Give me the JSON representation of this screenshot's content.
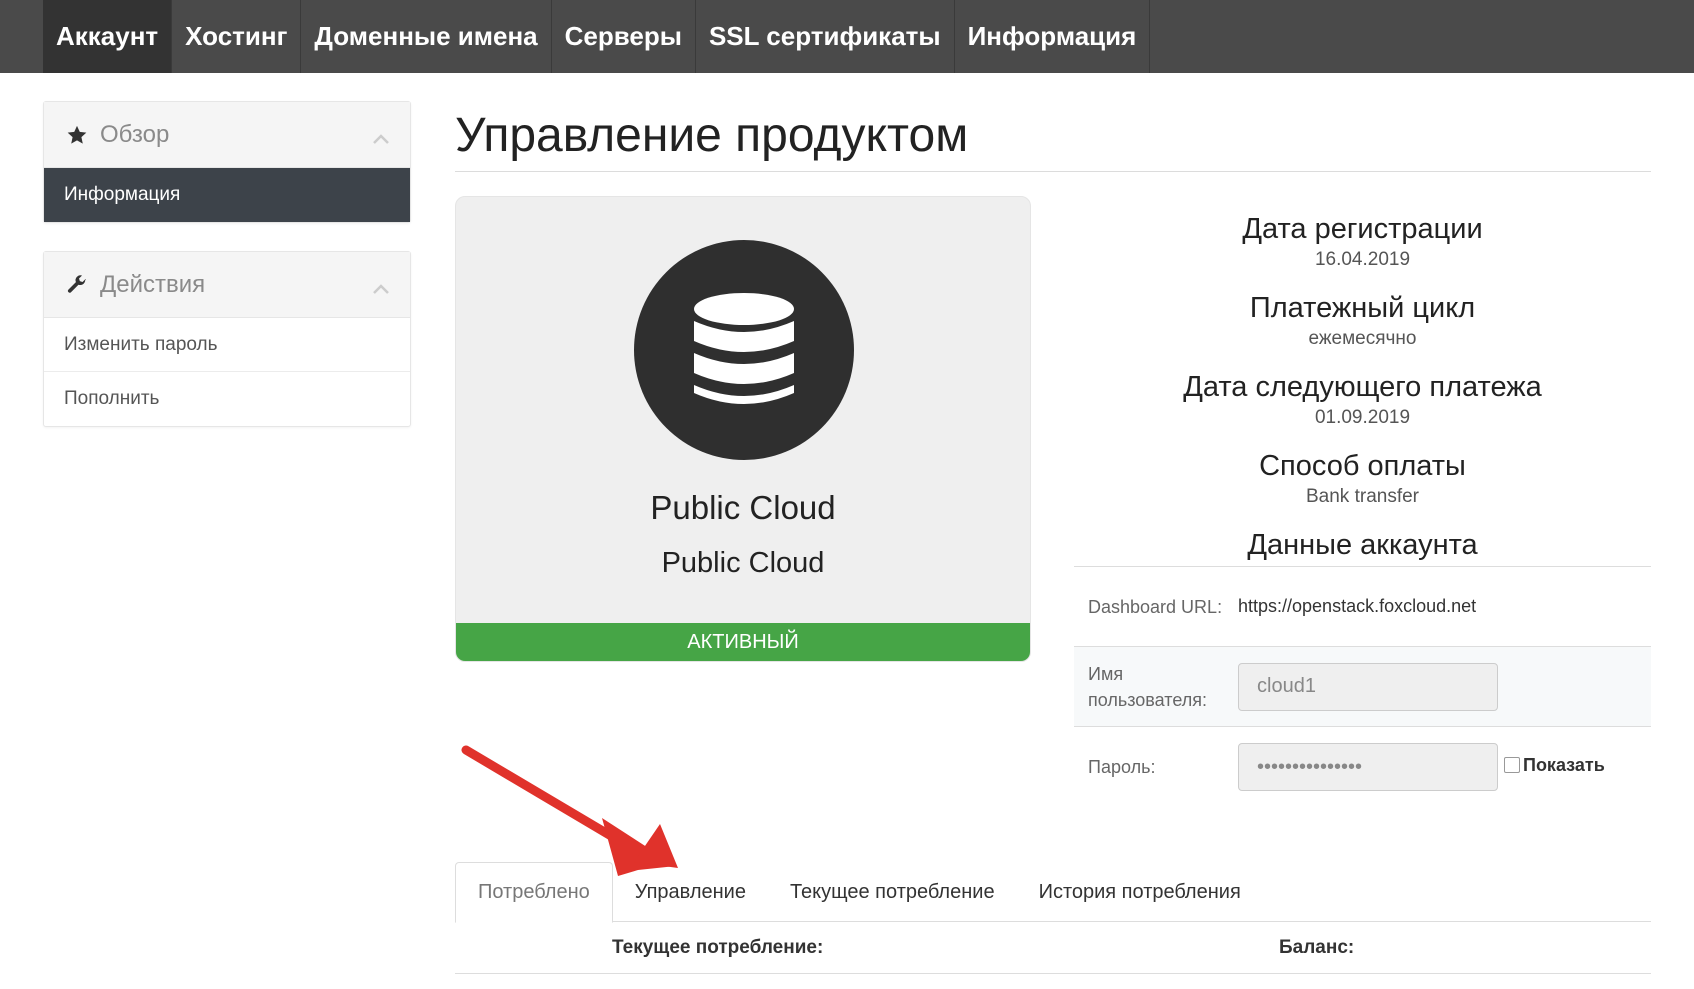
{
  "nav": {
    "items": [
      {
        "label": "Аккаунт",
        "active": true
      },
      {
        "label": "Хостинг",
        "active": false
      },
      {
        "label": "Доменные имена",
        "active": false
      },
      {
        "label": "Серверы",
        "active": false
      },
      {
        "label": "SSL сертификаты",
        "active": false
      },
      {
        "label": "Информация",
        "active": false
      }
    ]
  },
  "sidebar": {
    "overview": {
      "title": "Обзор",
      "icon": "star-icon",
      "items": [
        {
          "label": "Информация",
          "active": true
        }
      ]
    },
    "actions": {
      "title": "Действия",
      "icon": "wrench-icon",
      "items": [
        {
          "label": "Изменить пароль"
        },
        {
          "label": "Пополнить"
        }
      ]
    }
  },
  "main": {
    "title": "Управление продуктом",
    "product": {
      "icon": "database-icon",
      "name": "Public Cloud",
      "group": "Public Cloud",
      "status": "АКТИВНЫЙ",
      "status_color": "#46a546"
    },
    "info": [
      {
        "label": "Дата регистрации",
        "value": "16.04.2019"
      },
      {
        "label": "Платежный цикл",
        "value": "ежемесячно"
      },
      {
        "label": "Дата следующего платежа",
        "value": "01.09.2019"
      },
      {
        "label": "Способ оплаты",
        "value": "Bank transfer"
      }
    ],
    "account": {
      "title": "Данные аккаунта",
      "dashboard_label": "Dashboard URL:",
      "dashboard_url": "https://openstack.foxcloud.net",
      "username_label": "Имя пользователя:",
      "username_value": "cloud1",
      "password_label": "Пароль:",
      "password_value": "•••••••••••••••",
      "show_label": "Показать"
    },
    "tabs": [
      {
        "label": "Потреблено",
        "active": true
      },
      {
        "label": "Управление",
        "active": false
      },
      {
        "label": "Текущее потребление",
        "active": false
      },
      {
        "label": "История потребления",
        "active": false
      }
    ],
    "summary": {
      "current_label": "Текущее потребление:",
      "balance_label": "Баланс:"
    }
  },
  "annotation": {
    "arrow_color": "#e0322b",
    "arrow_icon": "arrow-annotation"
  }
}
